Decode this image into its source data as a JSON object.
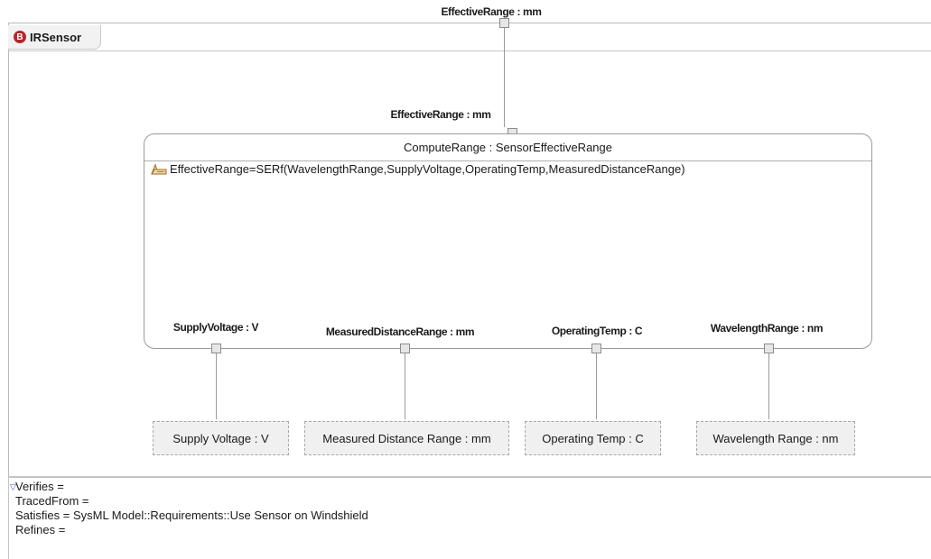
{
  "frame": {
    "title": "IRSensor",
    "badge": "B",
    "badge_color": "#b3262d",
    "boundary_port_label": "EffectiveRange : mm"
  },
  "constraint": {
    "name": "ComputeRange : SensorEffectiveRange",
    "expression": "EffectiveRange=SERf(WavelengthRange,SupplyVoltage,OperatingTemp,MeasuredDistanceRange)",
    "expression_icon": "constraint-icon",
    "top_port_label": "EffectiveRange : mm",
    "bottom_ports": [
      {
        "label": "SupplyVoltage : V"
      },
      {
        "label": "MeasuredDistanceRange : mm"
      },
      {
        "label": "OperatingTemp : C"
      },
      {
        "label": "WavelengthRange : nm"
      }
    ]
  },
  "value_properties": [
    {
      "label": "Supply Voltage : V"
    },
    {
      "label": "Measured Distance Range : mm"
    },
    {
      "label": "Operating Temp : C"
    },
    {
      "label": "Wavelength Range : nm"
    }
  ],
  "notes": {
    "toggle_icon": "triangle-down-icon",
    "lines": [
      "Verifies =",
      "TracedFrom =",
      "Satisfies = SysML Model::Requirements::Use  Sensor on Windshield",
      "Refines ="
    ]
  }
}
